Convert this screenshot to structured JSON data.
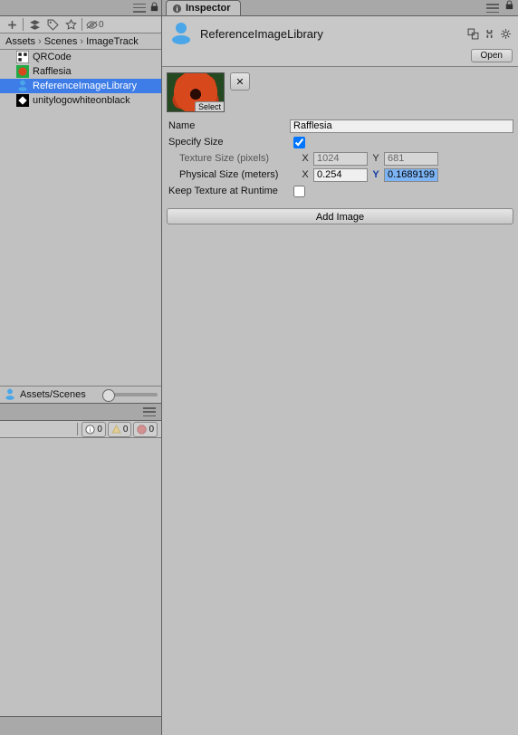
{
  "leftTabIcons": {
    "lock": "locked"
  },
  "toolbar": {
    "visibilityCount": "0"
  },
  "breadcrumb": [
    "Assets",
    "Scenes",
    "ImageTrack"
  ],
  "assets": [
    {
      "name": "QRCode",
      "iconType": "image",
      "selected": false
    },
    {
      "name": "Rafflesia",
      "iconType": "image-orange",
      "selected": false
    },
    {
      "name": "ReferenceImageLibrary",
      "iconType": "lib",
      "selected": true
    },
    {
      "name": "unitylogowhiteonblack",
      "iconType": "image-bw",
      "selected": false
    }
  ],
  "projectFooterPath": "Assets/Scenes",
  "console": {
    "infoCount": "0",
    "warnCount": "0",
    "errorCount": "0"
  },
  "inspector": {
    "tabLabel": "Inspector",
    "assetTitle": "ReferenceImageLibrary",
    "openLabel": "Open",
    "entry": {
      "selectBadge": "Select",
      "nameLabel": "Name",
      "nameValue": "Rafflesia",
      "specifySizeLabel": "Specify Size",
      "specifySizeValue": true,
      "textureSizeLabel": "Texture Size (pixels)",
      "textureSizeX": "1024",
      "textureSizeY": "681",
      "physicalSizeLabel": "Physical Size (meters)",
      "physicalSizeX": "0.254",
      "physicalSizeY": "0.1689199",
      "keepTextureLabel": "Keep Texture at Runtime",
      "keepTextureValue": false
    },
    "addImageLabel": "Add Image"
  }
}
